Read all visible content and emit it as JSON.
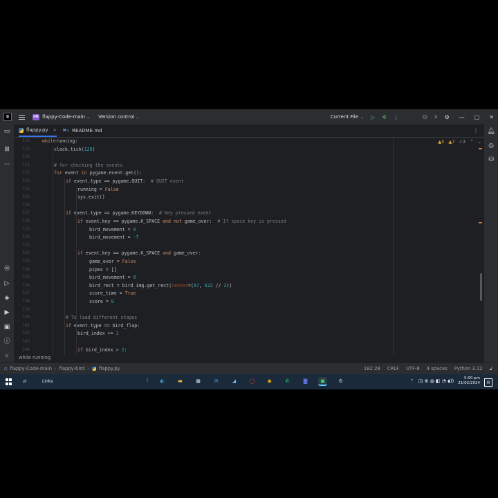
{
  "titlebar": {
    "logo": "IJ",
    "project_badge": "FM",
    "project_name": "flappy-Code-main",
    "vcs": "Version control",
    "run_config": "Current File"
  },
  "tabs": [
    {
      "label": "flappy.py",
      "active": true,
      "icon": "python-file-icon"
    },
    {
      "label": "README.md",
      "active": false,
      "icon": "markdown-file-icon"
    }
  ],
  "inspections": {
    "warnings": "5",
    "weak_warnings": "7",
    "typos": "2"
  },
  "code": {
    "line_numbers": [
      "118",
      "119",
      "120",
      "121",
      "122",
      "123",
      "124",
      "125",
      "126",
      "127",
      "128",
      "129",
      "130",
      "131",
      "132",
      "133",
      "134",
      "135",
      "136",
      "137",
      "138",
      "139",
      "140",
      "141",
      "142",
      "143",
      "144",
      "145"
    ],
    "lines": [
      {
        "indent": 0,
        "tokens": [
          [
            "kw",
            "while"
          ],
          [
            "",
            "running:"
          ]
        ]
      },
      {
        "indent": 1,
        "tokens": [
          [
            "",
            "clock.tick("
          ],
          [
            "nm",
            "120"
          ],
          [
            "",
            ")"
          ]
        ]
      },
      {
        "indent": 0,
        "tokens": []
      },
      {
        "indent": 1,
        "tokens": [
          [
            "cm",
            "# for checking the events"
          ]
        ]
      },
      {
        "indent": 1,
        "tokens": [
          [
            "kw",
            "for "
          ],
          [
            "",
            "event "
          ],
          [
            "kw",
            "in "
          ],
          [
            "",
            "pygame.event.get():"
          ]
        ]
      },
      {
        "indent": 2,
        "tokens": [
          [
            "kw",
            "if "
          ],
          [
            "",
            "event.type == pygame.QUIT:  "
          ],
          [
            "cm",
            "# QUIT event"
          ]
        ]
      },
      {
        "indent": 3,
        "tokens": [
          [
            "",
            "running = "
          ],
          [
            "kw",
            "False"
          ]
        ]
      },
      {
        "indent": 3,
        "tokens": [
          [
            "",
            "sys.exit()"
          ]
        ]
      },
      {
        "indent": 0,
        "tokens": []
      },
      {
        "indent": 2,
        "tokens": [
          [
            "kw",
            "if "
          ],
          [
            "",
            "event.type == pygame.KEYDOWN:  "
          ],
          [
            "cm",
            "# Key pressed event"
          ]
        ]
      },
      {
        "indent": 3,
        "tokens": [
          [
            "kw",
            "if "
          ],
          [
            "",
            "event.key == pygame.K_SPACE "
          ],
          [
            "kw",
            "and not "
          ],
          [
            "",
            "game_over:  "
          ],
          [
            "cm",
            "# If space key is pressed"
          ]
        ]
      },
      {
        "indent": 4,
        "tokens": [
          [
            "",
            "bird_movement = "
          ],
          [
            "nm",
            "0"
          ]
        ]
      },
      {
        "indent": 4,
        "tokens": [
          [
            "",
            "bird_movement = "
          ],
          [
            "nm",
            "-7"
          ]
        ]
      },
      {
        "indent": 0,
        "tokens": []
      },
      {
        "indent": 3,
        "tokens": [
          [
            "kw",
            "if "
          ],
          [
            "",
            "event.key == pygame.K_SPACE "
          ],
          [
            "kw",
            "and "
          ],
          [
            "",
            "game_over:"
          ]
        ]
      },
      {
        "indent": 4,
        "tokens": [
          [
            "",
            "game_over = "
          ],
          [
            "kw",
            "False"
          ]
        ]
      },
      {
        "indent": 4,
        "tokens": [
          [
            "",
            "pipes = []"
          ]
        ]
      },
      {
        "indent": 4,
        "tokens": [
          [
            "",
            "bird_movement = "
          ],
          [
            "nm",
            "0"
          ]
        ]
      },
      {
        "indent": 4,
        "tokens": [
          [
            "",
            "bird_rect = bird_img.get_rect("
          ],
          [
            "pm",
            "center"
          ],
          [
            "",
            "=("
          ],
          [
            "nm",
            "67"
          ],
          [
            "",
            ", "
          ],
          [
            "nm",
            "622"
          ],
          [
            "",
            " // "
          ],
          [
            "nm",
            "2"
          ],
          [
            "",
            "))"
          ]
        ]
      },
      {
        "indent": 4,
        "tokens": [
          [
            "",
            "score_time = "
          ],
          [
            "kw",
            "True"
          ]
        ]
      },
      {
        "indent": 4,
        "tokens": [
          [
            "",
            "score = "
          ],
          [
            "nm",
            "0"
          ]
        ]
      },
      {
        "indent": 0,
        "tokens": []
      },
      {
        "indent": 2,
        "tokens": [
          [
            "cm",
            "# To load different stages"
          ]
        ]
      },
      {
        "indent": 2,
        "tokens": [
          [
            "kw",
            "if "
          ],
          [
            "",
            "event.type == bird_flap:"
          ]
        ]
      },
      {
        "indent": 3,
        "tokens": [
          [
            "",
            "bird_index += "
          ],
          [
            "nm",
            "1"
          ]
        ]
      },
      {
        "indent": 0,
        "tokens": []
      },
      {
        "indent": 3,
        "tokens": [
          [
            "kw",
            "if "
          ],
          [
            "",
            "bird_index > "
          ],
          [
            "nm",
            "2"
          ],
          [
            "",
            ":"
          ]
        ]
      }
    ]
  },
  "sticky_context": "while running",
  "status": {
    "crumbs": [
      "flappy-Code-main",
      "flappy-bird",
      "flappy.py"
    ],
    "position": "182:28",
    "line_sep": "CRLF",
    "encoding": "UTF-8",
    "indent": "4 spaces",
    "interpreter": "Python 3.12"
  },
  "taskbar": {
    "links": "Links",
    "time": "5:00 pm",
    "date": "21/02/2024"
  }
}
